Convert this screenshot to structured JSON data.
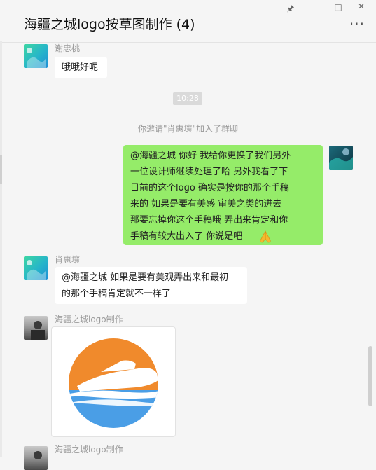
{
  "window": {
    "title": "海疆之城logo按草图制作 (4)"
  },
  "messages": {
    "m1_sender": "谢忠桃",
    "m1_text": "哦哦好呢",
    "time": "10:28",
    "system": "你邀请\"肖惠壤\"加入了群聊",
    "m2_lines": [
      "@海疆之城     你好  我给你更换了我们另外",
      "一位设计师继续处理了哈       另外我看了下",
      "目前的这个logo  确实是按你的那个手稿",
      "来的      如果是要有美感  审美之类的进去",
      "那要忘掉你这个手稿哦     弄出来肯定和你",
      "手稿有较大出入了    你说是吧"
    ],
    "m3_sender": "肖惠壤",
    "m3_lines": [
      "@海疆之城 如果是要有美观弄出来和最初",
      "的那个手稿肯定就不一样了"
    ],
    "m4_sender": "海疆之城logo制作",
    "m5_sender": "海疆之城logo制作"
  },
  "icons": {
    "pin": "pin-icon",
    "minimize": "minimize-icon",
    "maximize": "maximize-icon",
    "close": "close-icon",
    "more": "more-icon",
    "emoji": "folded-hands-emoji-icon"
  },
  "colors": {
    "my_bubble": "#95ec69",
    "logo_orange": "#f08a2c",
    "logo_blue": "#4a9ee6"
  }
}
